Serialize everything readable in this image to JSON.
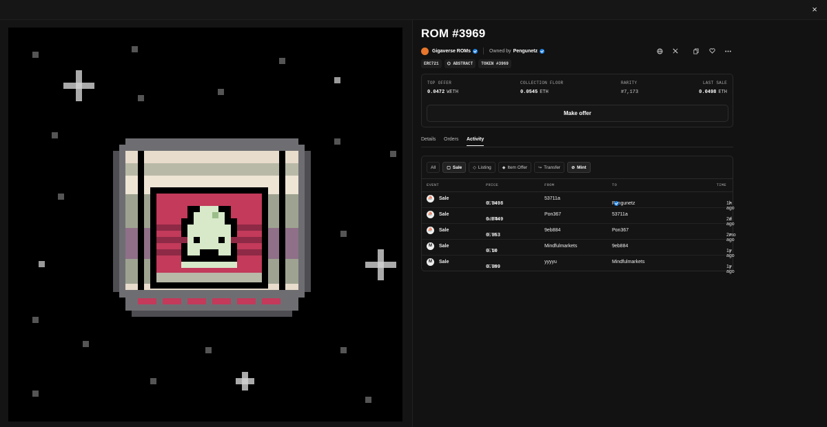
{
  "window": {
    "close_label": "×"
  },
  "nft": {
    "title": "ROM #3969",
    "collection": "Gigaverse ROMs",
    "owned_by_label": "Owned by",
    "owner": "Pengunetz",
    "tags": [
      "ERC721",
      "ABSTRACT",
      "TOKEN #3969"
    ]
  },
  "header_icons": [
    "globe-icon",
    "x-logo-icon",
    "copy-icon",
    "heart-icon",
    "more-icon"
  ],
  "stats": {
    "top_offer": {
      "label": "TOP OFFER",
      "value": "0.0472",
      "unit": "WETH"
    },
    "collection_floor": {
      "label": "COLLECTION FLOOR",
      "value": "0.0545",
      "unit": "ETH"
    },
    "rarity": {
      "label": "RARITY",
      "value": "#7,173"
    },
    "last_sale": {
      "label": "LAST SALE",
      "value": "0.0498",
      "unit": "ETH"
    }
  },
  "make_offer_label": "Make offer",
  "tabs": [
    "Details",
    "Orders",
    "Activity"
  ],
  "active_tab": "Activity",
  "filters": [
    {
      "label": "All",
      "active": false
    },
    {
      "label": "Sale",
      "active": true
    },
    {
      "label": "Listing",
      "active": false
    },
    {
      "label": "Item Offer",
      "active": false
    },
    {
      "label": "Transfer",
      "active": false
    },
    {
      "label": "Mint",
      "active": true
    }
  ],
  "table": {
    "headers": {
      "event": "EVENT",
      "price": "PRICE",
      "from": "FROM",
      "to": "TO",
      "time": "TIME"
    },
    "rows": [
      {
        "event": "Sale",
        "price": "0.0498",
        "unit": "ETH",
        "from": "53711a",
        "to": "Pengunetz",
        "to_verified": true,
        "time": "1h ago",
        "marketplace": "opensea"
      },
      {
        "event": "Sale",
        "price": "0.0449",
        "unit": "WETH",
        "from": "Pon367",
        "to": "53711a",
        "to_verified": false,
        "time": "2d ago",
        "marketplace": "opensea"
      },
      {
        "event": "Sale",
        "price": "0.053",
        "unit": "ETH",
        "from": "9eb884",
        "to": "Pon367",
        "to_verified": false,
        "time": "2mo ago",
        "marketplace": "opensea"
      },
      {
        "event": "Sale",
        "price": "0.10",
        "unit": "ETH",
        "from": "Mindfulmarkets",
        "to": "9eb884",
        "to_verified": false,
        "time": "1y ago",
        "marketplace": "magiceden"
      },
      {
        "event": "Sale",
        "price": "0.099",
        "unit": "ETH",
        "from": "yyyyu",
        "to": "Mindfulmarkets",
        "to_verified": false,
        "time": "1y ago",
        "marketplace": "magiceden"
      }
    ]
  }
}
